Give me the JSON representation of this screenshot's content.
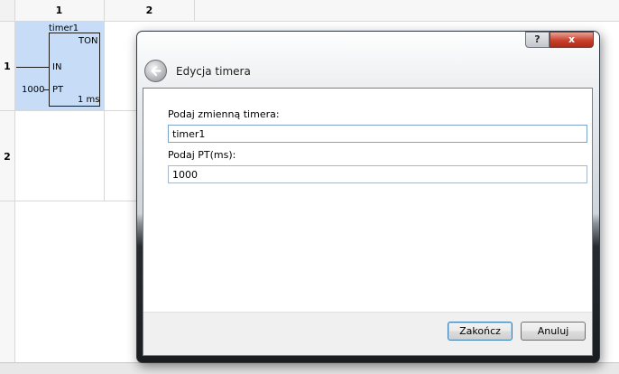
{
  "grid": {
    "columns": [
      "1",
      "2"
    ],
    "rows": [
      "1",
      "2"
    ]
  },
  "timer_block": {
    "name": "timer1",
    "type": "TON",
    "input_label": "IN",
    "pt_label": "PT",
    "pt_value": "1000",
    "unit": "1 ms"
  },
  "dialog": {
    "title": "Edycja timera",
    "help_glyph": "?",
    "close_glyph": "x",
    "timer_var_label": "Podaj zmienną timera:",
    "timer_var_value": "timer1",
    "pt_field_label": "Podaj PT(ms):",
    "pt_field_value": "1000",
    "finish_button": "Zakończ",
    "cancel_button": "Anuluj"
  }
}
